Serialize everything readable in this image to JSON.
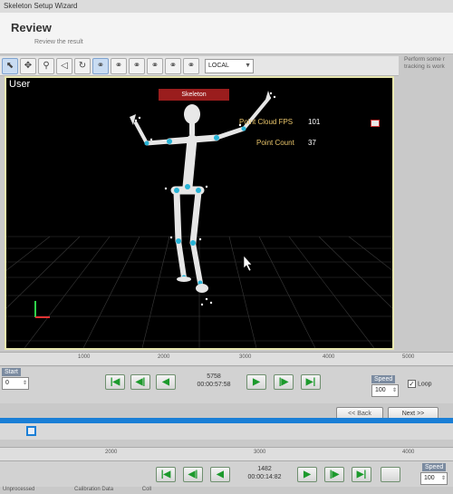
{
  "window": {
    "title": "Skeleton Setup Wizard"
  },
  "header": {
    "title": "Review",
    "subtitle": "Review the result"
  },
  "side_note": "Perform some r tracking is work",
  "toolbar": {
    "coordinate_mode": "LOCAL",
    "buttons": [
      "select-icon",
      "move-icon",
      "zoom-icon",
      "speaker-icon",
      "rotate-icon",
      "bone-icon",
      "bone-icon",
      "bone-icon",
      "bone-icon",
      "bone-icon",
      "bone-icon"
    ]
  },
  "viewport": {
    "label": "User",
    "skeleton_tag": "Skeleton",
    "point_cloud_fps_label": "Point Cloud FPS",
    "point_cloud_fps_value": "101",
    "point_count_label": "Point Count",
    "point_count_value": "37"
  },
  "timeline1": {
    "ticks": [
      "1000",
      "2000",
      "3000",
      "4000",
      "5000"
    ],
    "start_label": "Start",
    "start_value": "0",
    "frame": "5758",
    "timecode": "00:00:57:58",
    "speed_label": "Speed",
    "speed_value": "100",
    "loop_label": "Loop",
    "loop_checked": true
  },
  "wizard": {
    "back_label": "<< Back",
    "next_label": "Next >>"
  },
  "timeline2": {
    "ticks": [
      "2000",
      "3000",
      "4000"
    ],
    "frame": "1482",
    "timecode": "00:00:14:82",
    "speed_label": "Speed",
    "speed_value": "100"
  },
  "statusbar": {
    "left": "Unprocessed",
    "middle": "Calibration Data",
    "right": "Coll"
  },
  "colors": {
    "accent_blue": "#1a7fd6",
    "viewport_border": "#e9e8b0",
    "play_green": "#1c9a2c",
    "tag_red": "#9a1d1d"
  }
}
